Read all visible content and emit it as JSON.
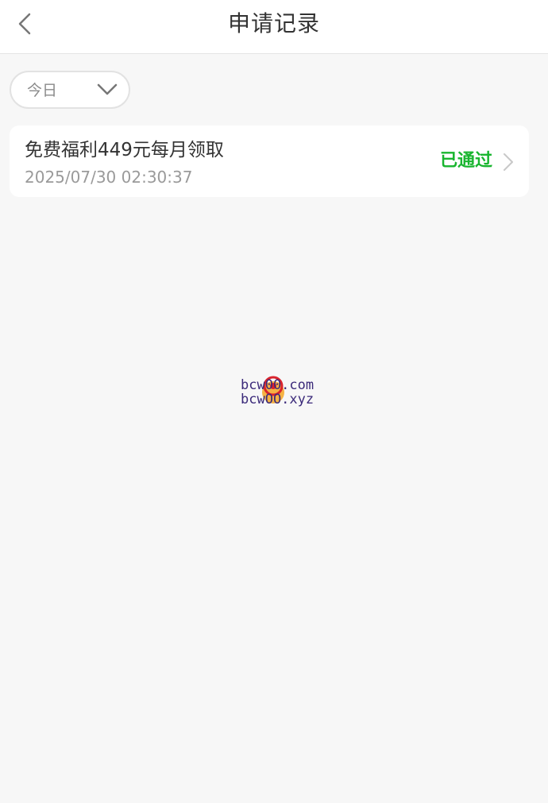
{
  "header": {
    "title": "申请记录",
    "back_icon": "chevron-left-icon"
  },
  "filter": {
    "selected": "今日",
    "icon": "chevron-down-icon"
  },
  "records": [
    {
      "title": "免费福利449元每月领取",
      "time": "2025/07/30 02:30:37",
      "status": "已通过",
      "status_color": "#19b52f"
    }
  ],
  "watermark": {
    "line1": "bcw00.com",
    "line2": "bcwOO.xyz"
  }
}
